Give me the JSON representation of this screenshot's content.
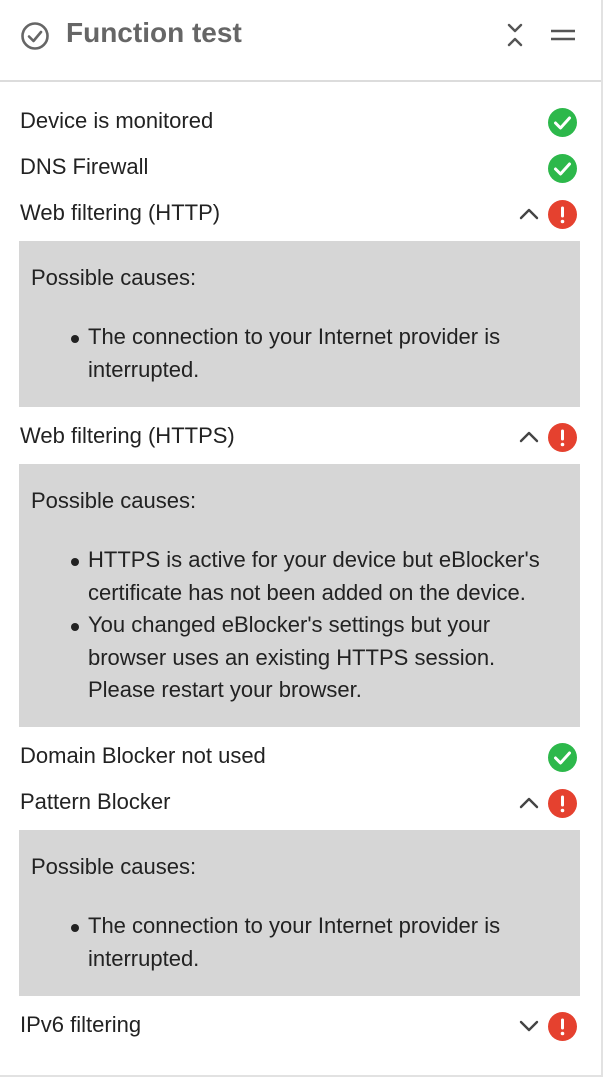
{
  "header": {
    "title": "Function test",
    "icons": [
      "check-circle-icon",
      "collapse-icon",
      "menu-icon"
    ]
  },
  "colors": {
    "ok": "#2db84b",
    "error": "#e5412f",
    "panel_bg": "#d6d6d6"
  },
  "checks": [
    {
      "label": "Device is monitored",
      "status": "ok"
    },
    {
      "label": "DNS Firewall",
      "status": "ok"
    },
    {
      "label": "Web filtering (HTTP)",
      "status": "error",
      "expanded": true,
      "causes_heading": "Possible causes:",
      "causes": [
        "The connection to your Internet provider is interrupted."
      ]
    },
    {
      "label": "Web filtering (HTTPS)",
      "status": "error",
      "expanded": true,
      "causes_heading": "Possible causes:",
      "causes": [
        "HTTPS is active for your device but eBlocker's certificate has not been added on the device.",
        "You changed eBlocker's settings but your browser uses an existing HTTPS session. Please restart your browser."
      ]
    },
    {
      "label": "Domain Blocker not used",
      "status": "ok"
    },
    {
      "label": "Pattern Blocker",
      "status": "error",
      "expanded": true,
      "causes_heading": "Possible causes:",
      "causes": [
        "The connection to your Internet provider is interrupted."
      ]
    },
    {
      "label": "IPv6 filtering",
      "status": "error",
      "expanded": false
    }
  ]
}
